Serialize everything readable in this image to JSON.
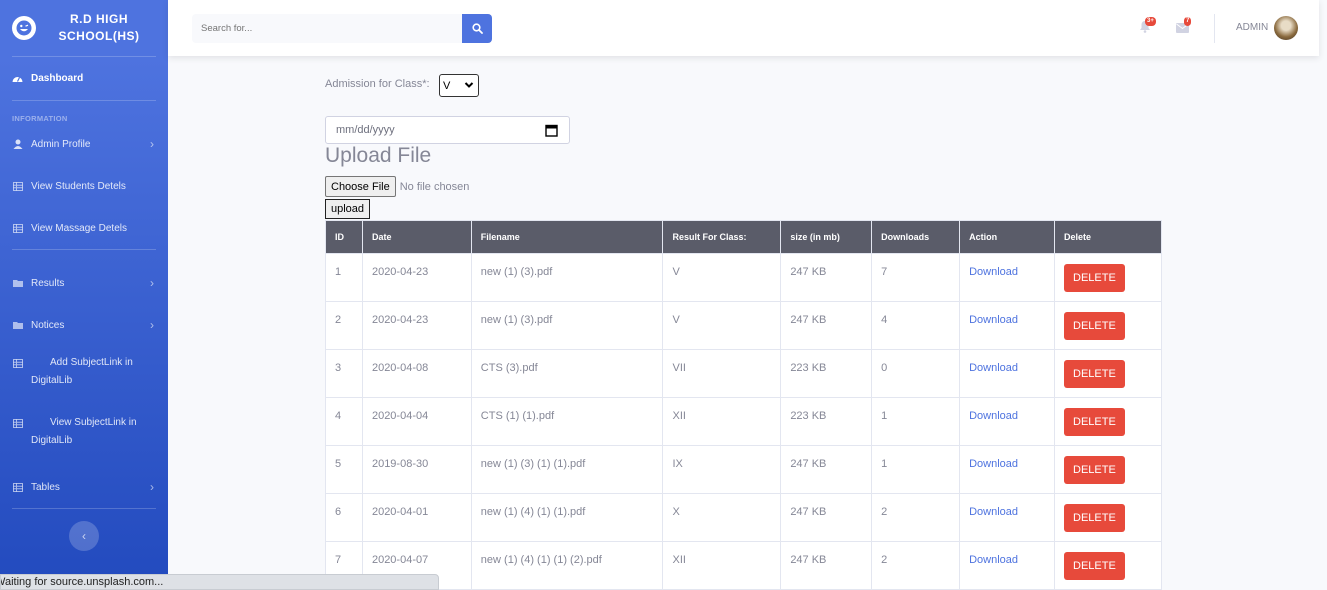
{
  "sidebar": {
    "brand_line1": "R.D HIGH",
    "brand_line2": "SCHOOL(HS)",
    "brand_icon": "laugh-wink-icon",
    "dashboard": "Dashboard",
    "section_heading": "INFORMATION",
    "items": [
      {
        "label": "Admin Profile",
        "icon": "user-icon",
        "chevron": true
      },
      {
        "label": "View Students Detels",
        "icon": "table-icon"
      },
      {
        "label": "View Massage Detels",
        "icon": "table-icon"
      },
      {
        "label": "Results",
        "icon": "folder-icon",
        "chevron": true
      },
      {
        "label": "Notices",
        "icon": "folder-icon",
        "chevron": true
      },
      {
        "label": "Add SubjectLink in DigitalLib",
        "icon": "table-icon"
      },
      {
        "label": "View SubjectLink in DigitalLib",
        "icon": "table-icon"
      },
      {
        "label": "Tables",
        "icon": "table-icon",
        "chevron": true
      }
    ]
  },
  "topbar": {
    "search_placeholder": "Search for...",
    "alerts_badge": "3+",
    "messages_badge": "7",
    "user_name": "ADMIN"
  },
  "form": {
    "admission_label": "Admission for Class*:",
    "class_value": "V",
    "date_placeholder": "mm/dd/yyyy",
    "upload_title": "Upload File",
    "choose_file": "Choose File",
    "no_file": "No file chosen",
    "upload_button": "upload"
  },
  "table": {
    "headers": [
      "ID",
      "Date",
      "Filename",
      "Result For Class:",
      "size (in mb)",
      "Downloads",
      "Action",
      "Delete"
    ],
    "rows": [
      {
        "id": "1",
        "date": "2020-04-23",
        "filename": "new (1) (3).pdf",
        "class": "V",
        "size": "247 KB",
        "downloads": "7",
        "action": "Download",
        "delete": "DELETE"
      },
      {
        "id": "2",
        "date": "2020-04-23",
        "filename": "new (1) (3).pdf",
        "class": "V",
        "size": "247 KB",
        "downloads": "4",
        "action": "Download",
        "delete": "DELETE"
      },
      {
        "id": "3",
        "date": "2020-04-08",
        "filename": "CTS (3).pdf",
        "class": "VII",
        "size": "223 KB",
        "downloads": "0",
        "action": "Download",
        "delete": "DELETE"
      },
      {
        "id": "4",
        "date": "2020-04-04",
        "filename": "CTS (1) (1).pdf",
        "class": "XII",
        "size": "223 KB",
        "downloads": "1",
        "action": "Download",
        "delete": "DELETE"
      },
      {
        "id": "5",
        "date": "2019-08-30",
        "filename": "new (1) (3) (1) (1).pdf",
        "class": "IX",
        "size": "247 KB",
        "downloads": "1",
        "action": "Download",
        "delete": "DELETE"
      },
      {
        "id": "6",
        "date": "2020-04-01",
        "filename": "new (1) (4) (1) (1).pdf",
        "class": "X",
        "size": "247 KB",
        "downloads": "2",
        "action": "Download",
        "delete": "DELETE"
      },
      {
        "id": "7",
        "date": "2020-04-07",
        "filename": "new (1) (4) (1) (1) (2).pdf",
        "class": "XII",
        "size": "247 KB",
        "downloads": "2",
        "action": "Download",
        "delete": "DELETE"
      }
    ]
  },
  "status_bar": "Waiting for source.unsplash.com...",
  "colors": {
    "primary": "#4e73df",
    "danger": "#e74a3b",
    "header_dark": "#5a5c69"
  }
}
